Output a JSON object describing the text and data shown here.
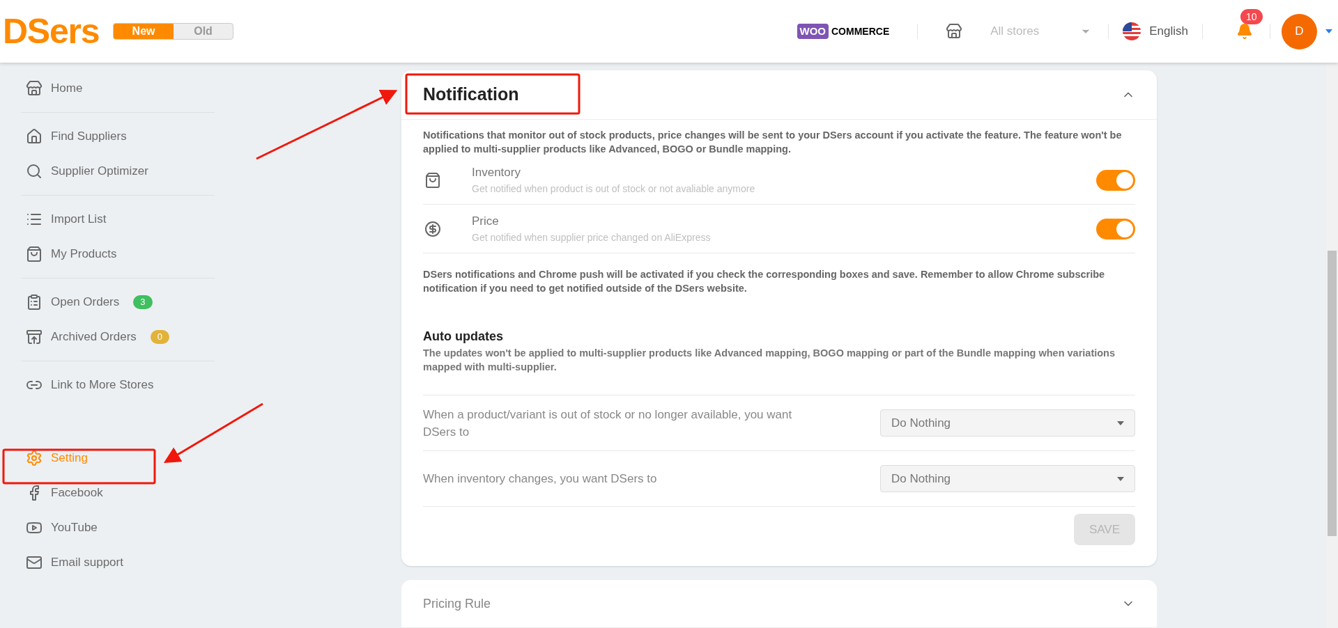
{
  "header": {
    "logo": "DSers",
    "version_switch": [
      {
        "label": "New",
        "selected": true
      },
      {
        "label": "Old",
        "selected": false
      }
    ],
    "platform_logo": {
      "left": "WOO",
      "right": "COMMERCE"
    },
    "store_select": {
      "placeholder": "All stores"
    },
    "language": "English",
    "notification_count": "10",
    "avatar_initial": "D"
  },
  "sidebar": {
    "groups": [
      [
        {
          "label": "Home",
          "kind": "store",
          "selected": false
        }
      ],
      [
        {
          "label": "Find Suppliers",
          "kind": "house",
          "selected": false
        },
        {
          "label": "Supplier Optimizer",
          "kind": "search",
          "selected": false
        }
      ],
      [
        {
          "label": "Import List",
          "kind": "list",
          "selected": false
        },
        {
          "label": "My Products",
          "kind": "bag",
          "selected": false
        }
      ],
      [
        {
          "label": "Open Orders",
          "kind": "clipboard",
          "badge": "3",
          "color": "#3fbf5f",
          "selected": false
        },
        {
          "label": "Archived Orders",
          "kind": "archive",
          "badge": "0",
          "color": "#e2b33a",
          "selected": false
        }
      ],
      [
        {
          "label": "Link to More Stores",
          "kind": "link",
          "selected": false
        }
      ]
    ],
    "bottom": [
      {
        "label": "Setting",
        "kind": "gear",
        "selected": true
      },
      {
        "label": "Facebook",
        "kind": "facebook",
        "selected": false
      },
      {
        "label": "YouTube",
        "kind": "youtube",
        "selected": false
      },
      {
        "label": "Email support",
        "kind": "mail",
        "selected": false
      }
    ]
  },
  "notification": {
    "title": "Notification",
    "expanded": true,
    "description": "Notifications that monitor out of stock products, price changes will be sent to your DSers account if you activate the feature. The feature won't be applied to multi-supplier products like Advanced, BOGO or Bundle mapping.",
    "items": [
      {
        "kind": "bag",
        "title": "Inventory",
        "subtitle": "Get notified when product is out of stock or not avaliable anymore",
        "on": true
      },
      {
        "kind": "dollar",
        "title": "Price",
        "subtitle": "Get notified when supplier price changed on AliExpress",
        "on": true
      }
    ],
    "note": "DSers notifications and Chrome push will be activated if you check the corresponding boxes and save. Remember to allow Chrome subscribe notification if you need to get notified outside of the DSers website.",
    "auto_updates": {
      "title": "Auto updates",
      "description": "The updates won't be applied to multi-supplier products like Advanced mapping, BOGO mapping or part of the Bundle mapping when variations mapped with multi-supplier.",
      "rules": [
        {
          "label": "When a product/variant is out of stock or no longer available, you want DSers to",
          "value": "Do Nothing"
        },
        {
          "label": "When inventory changes, you want DSers to",
          "value": "Do Nothing"
        }
      ]
    },
    "save_button": {
      "label": "SAVE",
      "disabled": true
    }
  },
  "pricing_rule": {
    "title": "Pricing Rule",
    "expanded": false
  }
}
